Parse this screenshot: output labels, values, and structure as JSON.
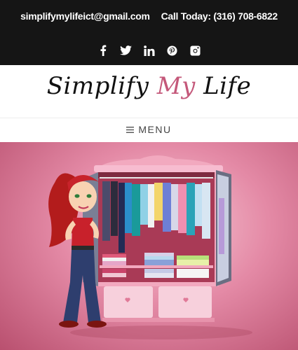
{
  "contact": {
    "email": "simplifymylifeict@gmail.com",
    "phone": "Call Today: (316) 708-6822"
  },
  "social": [
    {
      "name": "facebook-icon"
    },
    {
      "name": "twitter-icon"
    },
    {
      "name": "linkedin-icon"
    },
    {
      "name": "pinterest-icon"
    },
    {
      "name": "instagram-icon"
    }
  ],
  "logo": {
    "part1": "Simplify ",
    "accent": "My",
    "part2": " Life",
    "accent_color": "#c4587a"
  },
  "menu": {
    "icon": "hamburger-icon",
    "label": "MENU"
  },
  "colors": {
    "topbar": "#151515",
    "hero_bg": "#e48aa6"
  }
}
